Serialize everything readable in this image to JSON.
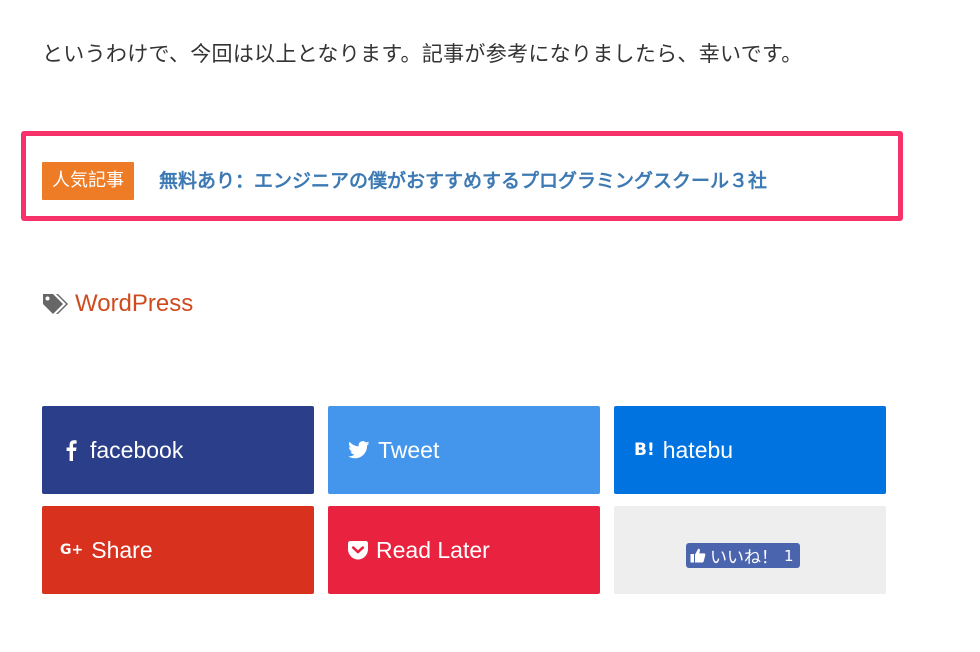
{
  "article": {
    "closing_text": "というわけで、今回は以上となります。記事が参考になりましたら、幸いです。"
  },
  "popular": {
    "badge": "人気記事",
    "link_text": "無料あり：エンジニアの僕がおすすめするプログラミングスクール３社"
  },
  "tags": {
    "icon": "tags-icon",
    "items": [
      "WordPress"
    ]
  },
  "share": {
    "facebook": {
      "label": "facebook",
      "icon": "facebook-icon",
      "color": "#2b3e8a"
    },
    "twitter": {
      "label": "Tweet",
      "icon": "twitter-bird-icon",
      "color": "#4396ec"
    },
    "hatebu": {
      "label": "hatebu",
      "icon": "hatena-bookmark-icon",
      "glyph": "B!",
      "color": "#0073e0"
    },
    "gplus": {
      "label": "Share",
      "icon": "google-plus-icon",
      "glyph": "G+",
      "color": "#d8321f"
    },
    "pocket": {
      "label": "Read Later",
      "icon": "pocket-icon",
      "color": "#e9233f"
    },
    "fb_like": {
      "label": "いいね！",
      "count": "1",
      "icon": "thumbs-up-icon",
      "color": "#4a64ad"
    }
  },
  "colors": {
    "highlight_border": "#f7326a",
    "badge": "#ee7b25",
    "link": "#3d7ab3",
    "tag_link": "#cf4b1f"
  }
}
